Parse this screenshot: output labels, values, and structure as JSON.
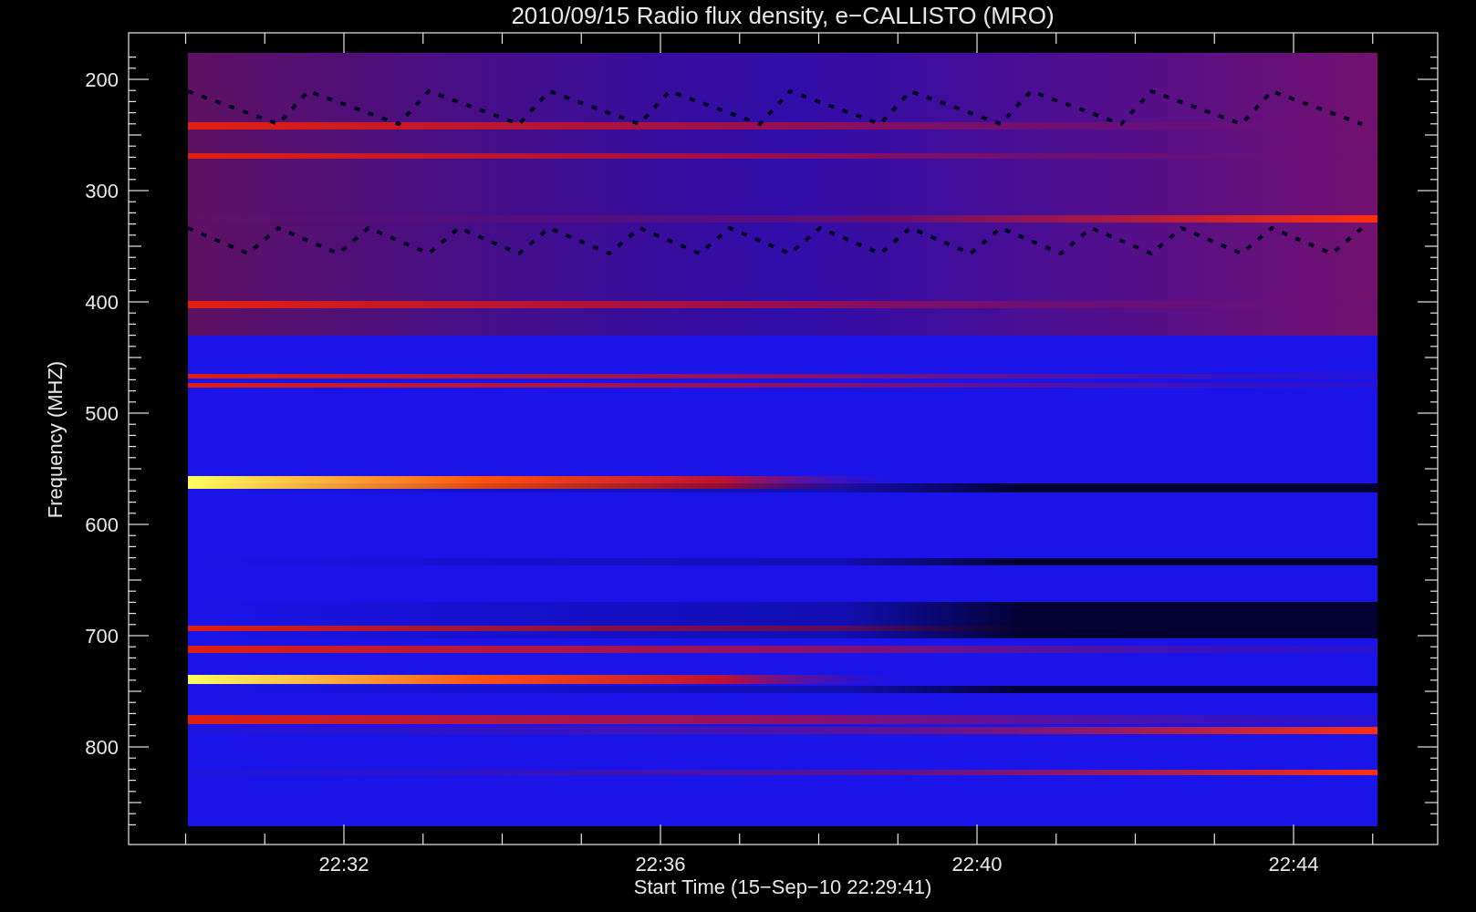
{
  "plot": {
    "title": "2010/09/15  Radio flux density, e−CALLISTO (MRO)",
    "ylabel": "Frequency (MHZ)",
    "yticks": [
      "200",
      "300",
      "400",
      "500",
      "600",
      "700",
      "800"
    ],
    "xticks": [
      "22:32",
      "22:36",
      "22:40",
      "22:44"
    ],
    "xlabel": "Start Time (15−Sep−10 22:29:41)"
  }
}
